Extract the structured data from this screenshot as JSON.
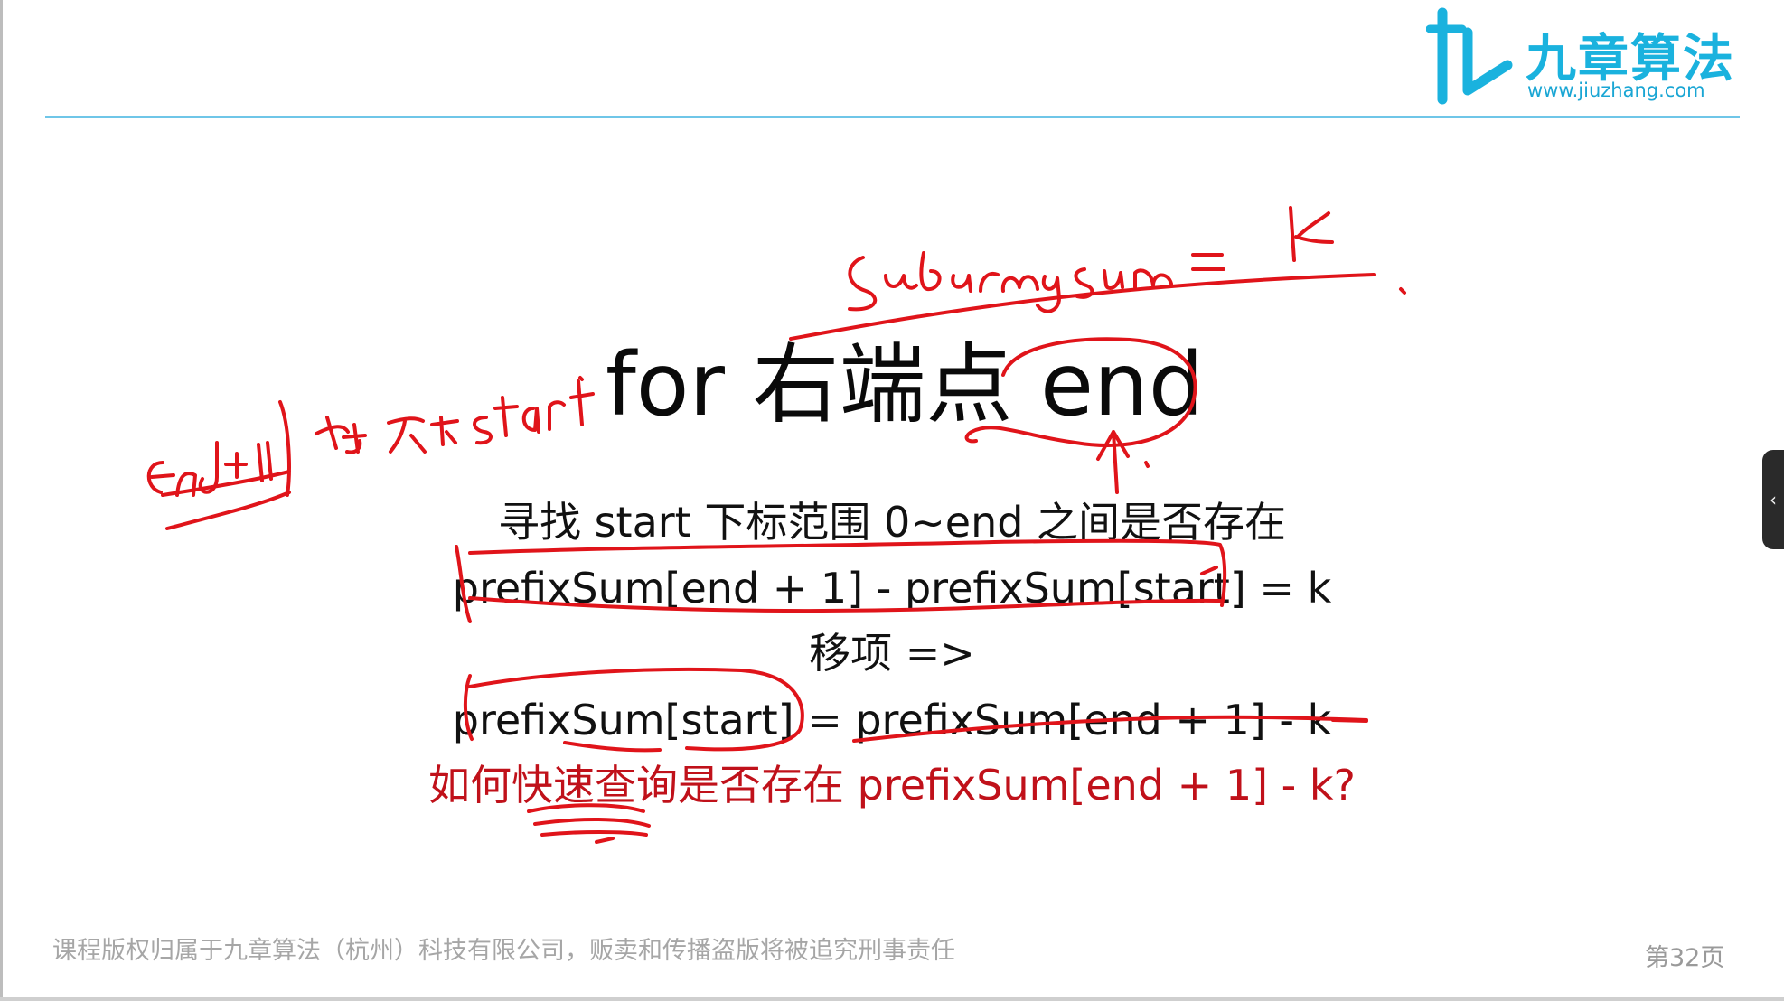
{
  "brand": {
    "name": "九章算法",
    "url": "www.jiuzhang.com",
    "accent_color": "#1ab2de"
  },
  "slide": {
    "title": "for 右端点 end",
    "lines": [
      "寻找 start 下标范围 0~end 之间是否存在",
      "prefixSum[end + 1] - prefixSum[start] = k",
      "移项 =>",
      "prefixSum[start] = prefixSum[end + 1] - k"
    ],
    "question": "如何快速查询是否存在 prefixSum[end + 1] - k?",
    "question_color": "#c0111a"
  },
  "annotations": {
    "ink_color": "#e0141a",
    "top_note": "subarray sum = k",
    "left_note": "end+1 存在 start"
  },
  "footer": {
    "copyright": "课程版权归属于九章算法（杭州）科技有限公司，贩卖和传播盗版将被追究刑事责任",
    "page": "第32页"
  },
  "side_panel": {
    "toggle_icon": "chevron-left-icon",
    "toggle_glyph": "‹"
  }
}
